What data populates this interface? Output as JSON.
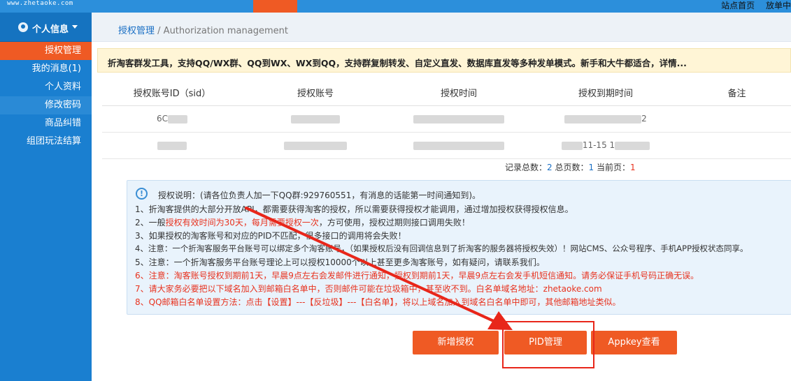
{
  "topbar": {
    "domain": "www.zhetaoke.com",
    "links": [
      "站点首页",
      "放单中"
    ]
  },
  "sidebar": {
    "user_label": "个人信息",
    "items": [
      {
        "label": "授权管理"
      },
      {
        "label": "我的消息(1)"
      },
      {
        "label": "个人资料"
      },
      {
        "label": "修改密码"
      },
      {
        "label": "商品纠错"
      },
      {
        "label": "组团玩法结算"
      }
    ]
  },
  "breadcrumb": {
    "current": "授权管理",
    "separator": " / ",
    "english": "Authorization management"
  },
  "notice": "折淘客群发工具，支持QQ/WX群、QQ到WX、WX到QQ，支持群复制转发、自定义直发、数据库直发等多种发单模式。新手和大牛都适合，详情...",
  "table": {
    "headers": [
      "授权账号ID（sid）",
      "授权账号",
      "授权时间",
      "授权到期时间",
      "备注"
    ],
    "rows": [
      {
        "sid": "6C",
        "account": "",
        "time": "",
        "expire": "2",
        "note": ""
      },
      {
        "sid": "",
        "account": "",
        "time": "",
        "expire": "11-15 1",
        "note": ""
      }
    ]
  },
  "pager": {
    "total_label": "记录总数：",
    "total": "2",
    "pages_label": " 总页数：",
    "pages": "1",
    "current_label": " 当前页：",
    "current": "1"
  },
  "info": {
    "title": "授权说明：(请各位负责人加一下QQ群:929760551，有消息的话能第一时间通知到)。",
    "line1": "1、折淘客提供的大部分开放API，都需要获得淘客的授权，所以需要获得授权才能调用，通过增加授权获得授权信息。",
    "line2_pre": "2、一般",
    "line2_red": "授权有效时间为30天，每月需要授权一次",
    "line2_post": "，方可使用，授权过期则接口调用失败！",
    "line3": "3、如果授权的淘客账号和对应的PID不匹配，很多接口的调用将会失败！",
    "line4": "4、注意：一个折淘客服务平台账号可以绑定多个淘客账号，（如果授权后没有回调信息到了折淘客的服务器将授权失效）！网站CMS、公众号程序、手机APP授权状态同享。",
    "line5": "5、注意：一个折淘客服务平台账号理论上可以授权10000个以上甚至更多淘客账号，如有疑问，请联系我们。",
    "line6": "6、注意：淘客账号授权到期前1天，早晨9点左右会发邮件进行通知，授权到期前1天，早晨9点左右会发手机短信通知。请务必保证手机号码正确无误。",
    "line7_pre": "7、请大家务必要把以下域名加入到邮箱白名单中，否则邮件可能在垃圾箱中，甚至收不到。白名单域名地址：",
    "line7_domain": "zhetaoke.com",
    "line8": "8、QQ邮箱白名单设置方法：点击【设置】---【反垃圾】---【白名单】，将以上域名加入到域名白名单中即可，其他邮箱地址类似。"
  },
  "buttons": {
    "add": "新增授权",
    "pid": "PID管理",
    "appkey": "Appkey查看"
  },
  "colors": {
    "accent": "#ef5a24",
    "sidebar": "#1a7fd0",
    "annotation": "#e8261a"
  }
}
